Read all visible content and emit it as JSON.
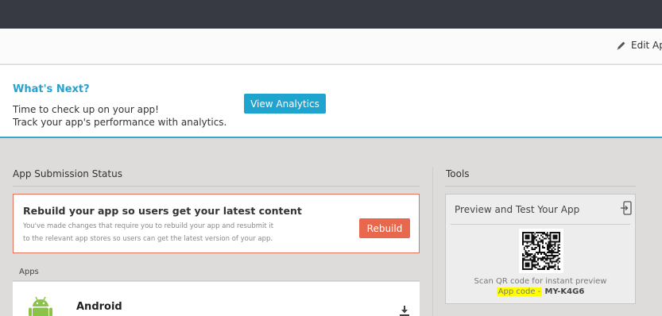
{
  "header": {
    "edit_app_label": "Edit Ap"
  },
  "whats_next": {
    "title": "What's Next?",
    "line1": "Time to check up on your app!",
    "line2": "Track your app's performance with analytics.",
    "button_label": "View Analytics"
  },
  "submission": {
    "section_title": "App Submission Status",
    "card_title": "Rebuild your app so users get your latest content",
    "card_line1": "You've made changes that require you to rebuild your app and resubmit it",
    "card_line2": "to the relevant app stores so users can get the latest version of your app.",
    "rebuild_label": "Rebuild"
  },
  "apps": {
    "label": "Apps",
    "items": [
      {
        "name": "Android",
        "icon": "android-icon"
      }
    ]
  },
  "tools": {
    "section_title": "Tools",
    "card_title": "Preview and Test Your App",
    "scan_text": "Scan QR code for instant preview",
    "app_code_label": "App code",
    "app_code_separator": "-",
    "app_code_value": "MY-K4G6"
  },
  "colors": {
    "topbar": "#373a42",
    "accent_blue": "#1fa4cf",
    "title_blue": "#27a2d0",
    "rebuild_orange": "#e8684e",
    "android_green": "#8bc34a",
    "highlight": "#ffff00"
  }
}
